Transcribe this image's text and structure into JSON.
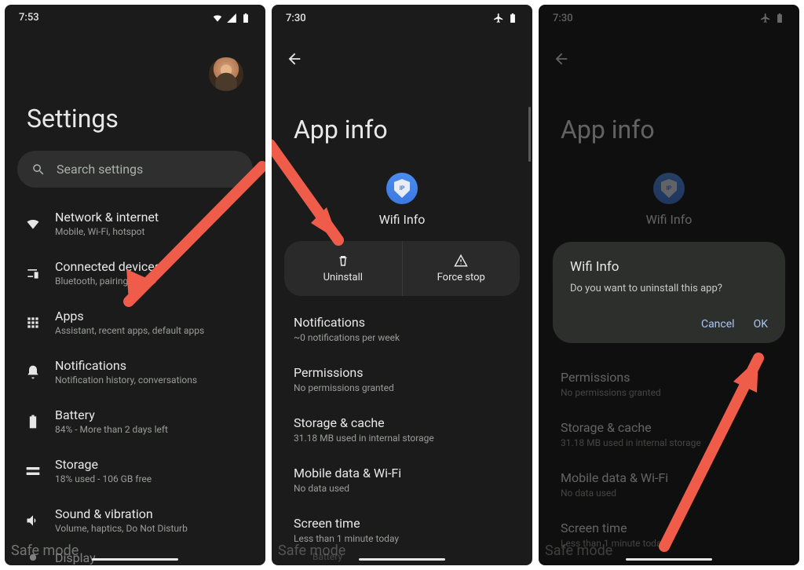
{
  "phone1": {
    "time": "7:53",
    "title": "Settings",
    "search_placeholder": "Search settings",
    "safe_mode": "Safe mode",
    "items": [
      {
        "label": "Network & internet",
        "sub": "Mobile, Wi-Fi, hotspot"
      },
      {
        "label": "Connected devices",
        "sub": "Bluetooth, pairing"
      },
      {
        "label": "Apps",
        "sub": "Assistant, recent apps, default apps"
      },
      {
        "label": "Notifications",
        "sub": "Notification history, conversations"
      },
      {
        "label": "Battery",
        "sub": "84% - More than 2 days left"
      },
      {
        "label": "Storage",
        "sub": "18% used - 106 GB free"
      },
      {
        "label": "Sound & vibration",
        "sub": "Volume, haptics, Do Not Disturb"
      }
    ],
    "display_cut": "Display"
  },
  "phone2": {
    "time": "7:30",
    "title": "App info",
    "app_name": "Wifi Info",
    "app_ip": "IP",
    "uninstall": "Uninstall",
    "force_stop": "Force stop",
    "safe_mode": "Safe mode",
    "rows": [
      {
        "label": "Notifications",
        "sub": "~0 notifications per week"
      },
      {
        "label": "Permissions",
        "sub": "No permissions granted"
      },
      {
        "label": "Storage & cache",
        "sub": "31.18 MB used in internal storage"
      },
      {
        "label": "Mobile data & Wi-Fi",
        "sub": "No data used"
      },
      {
        "label": "Screen time",
        "sub": "Less than 1 minute today"
      }
    ],
    "battery_cut": "Battery"
  },
  "phone3": {
    "time": "7:30",
    "title": "App info",
    "app_name": "Wifi Info",
    "app_ip": "IP",
    "safe_mode": "Safe mode",
    "rows": [
      {
        "label": "Permissions",
        "sub": "No permissions granted"
      },
      {
        "label": "Storage & cache",
        "sub": "31.18 MB used in internal storage"
      },
      {
        "label": "Mobile data & Wi-Fi",
        "sub": "No data used"
      },
      {
        "label": "Screen time",
        "sub": "Less than 1 minute today"
      }
    ],
    "dialog": {
      "title": "Wifi Info",
      "message": "Do you want to uninstall this app?",
      "cancel": "Cancel",
      "ok": "OK"
    }
  }
}
